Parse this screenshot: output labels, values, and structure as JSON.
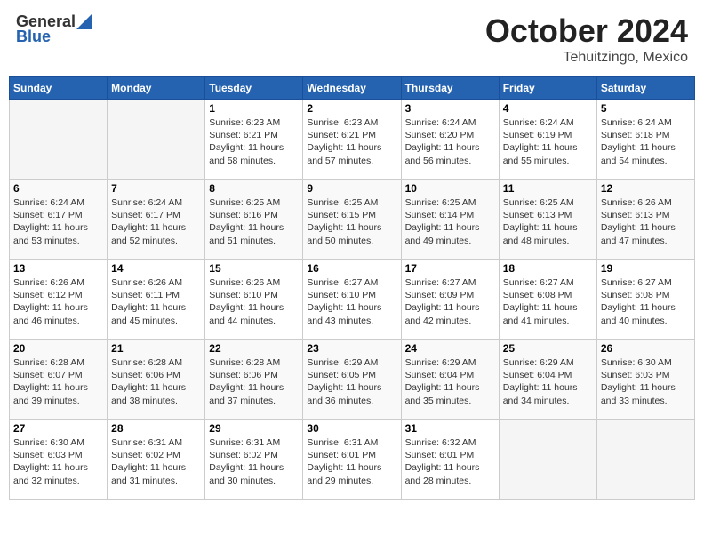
{
  "header": {
    "logo_line1": "General",
    "logo_line2": "Blue",
    "month": "October 2024",
    "location": "Tehuitzingo, Mexico"
  },
  "weekdays": [
    "Sunday",
    "Monday",
    "Tuesday",
    "Wednesday",
    "Thursday",
    "Friday",
    "Saturday"
  ],
  "weeks": [
    [
      {
        "day": "",
        "info": ""
      },
      {
        "day": "",
        "info": ""
      },
      {
        "day": "1",
        "info": "Sunrise: 6:23 AM\nSunset: 6:21 PM\nDaylight: 11 hours and 58 minutes."
      },
      {
        "day": "2",
        "info": "Sunrise: 6:23 AM\nSunset: 6:21 PM\nDaylight: 11 hours and 57 minutes."
      },
      {
        "day": "3",
        "info": "Sunrise: 6:24 AM\nSunset: 6:20 PM\nDaylight: 11 hours and 56 minutes."
      },
      {
        "day": "4",
        "info": "Sunrise: 6:24 AM\nSunset: 6:19 PM\nDaylight: 11 hours and 55 minutes."
      },
      {
        "day": "5",
        "info": "Sunrise: 6:24 AM\nSunset: 6:18 PM\nDaylight: 11 hours and 54 minutes."
      }
    ],
    [
      {
        "day": "6",
        "info": "Sunrise: 6:24 AM\nSunset: 6:17 PM\nDaylight: 11 hours and 53 minutes."
      },
      {
        "day": "7",
        "info": "Sunrise: 6:24 AM\nSunset: 6:17 PM\nDaylight: 11 hours and 52 minutes."
      },
      {
        "day": "8",
        "info": "Sunrise: 6:25 AM\nSunset: 6:16 PM\nDaylight: 11 hours and 51 minutes."
      },
      {
        "day": "9",
        "info": "Sunrise: 6:25 AM\nSunset: 6:15 PM\nDaylight: 11 hours and 50 minutes."
      },
      {
        "day": "10",
        "info": "Sunrise: 6:25 AM\nSunset: 6:14 PM\nDaylight: 11 hours and 49 minutes."
      },
      {
        "day": "11",
        "info": "Sunrise: 6:25 AM\nSunset: 6:13 PM\nDaylight: 11 hours and 48 minutes."
      },
      {
        "day": "12",
        "info": "Sunrise: 6:26 AM\nSunset: 6:13 PM\nDaylight: 11 hours and 47 minutes."
      }
    ],
    [
      {
        "day": "13",
        "info": "Sunrise: 6:26 AM\nSunset: 6:12 PM\nDaylight: 11 hours and 46 minutes."
      },
      {
        "day": "14",
        "info": "Sunrise: 6:26 AM\nSunset: 6:11 PM\nDaylight: 11 hours and 45 minutes."
      },
      {
        "day": "15",
        "info": "Sunrise: 6:26 AM\nSunset: 6:10 PM\nDaylight: 11 hours and 44 minutes."
      },
      {
        "day": "16",
        "info": "Sunrise: 6:27 AM\nSunset: 6:10 PM\nDaylight: 11 hours and 43 minutes."
      },
      {
        "day": "17",
        "info": "Sunrise: 6:27 AM\nSunset: 6:09 PM\nDaylight: 11 hours and 42 minutes."
      },
      {
        "day": "18",
        "info": "Sunrise: 6:27 AM\nSunset: 6:08 PM\nDaylight: 11 hours and 41 minutes."
      },
      {
        "day": "19",
        "info": "Sunrise: 6:27 AM\nSunset: 6:08 PM\nDaylight: 11 hours and 40 minutes."
      }
    ],
    [
      {
        "day": "20",
        "info": "Sunrise: 6:28 AM\nSunset: 6:07 PM\nDaylight: 11 hours and 39 minutes."
      },
      {
        "day": "21",
        "info": "Sunrise: 6:28 AM\nSunset: 6:06 PM\nDaylight: 11 hours and 38 minutes."
      },
      {
        "day": "22",
        "info": "Sunrise: 6:28 AM\nSunset: 6:06 PM\nDaylight: 11 hours and 37 minutes."
      },
      {
        "day": "23",
        "info": "Sunrise: 6:29 AM\nSunset: 6:05 PM\nDaylight: 11 hours and 36 minutes."
      },
      {
        "day": "24",
        "info": "Sunrise: 6:29 AM\nSunset: 6:04 PM\nDaylight: 11 hours and 35 minutes."
      },
      {
        "day": "25",
        "info": "Sunrise: 6:29 AM\nSunset: 6:04 PM\nDaylight: 11 hours and 34 minutes."
      },
      {
        "day": "26",
        "info": "Sunrise: 6:30 AM\nSunset: 6:03 PM\nDaylight: 11 hours and 33 minutes."
      }
    ],
    [
      {
        "day": "27",
        "info": "Sunrise: 6:30 AM\nSunset: 6:03 PM\nDaylight: 11 hours and 32 minutes."
      },
      {
        "day": "28",
        "info": "Sunrise: 6:31 AM\nSunset: 6:02 PM\nDaylight: 11 hours and 31 minutes."
      },
      {
        "day": "29",
        "info": "Sunrise: 6:31 AM\nSunset: 6:02 PM\nDaylight: 11 hours and 30 minutes."
      },
      {
        "day": "30",
        "info": "Sunrise: 6:31 AM\nSunset: 6:01 PM\nDaylight: 11 hours and 29 minutes."
      },
      {
        "day": "31",
        "info": "Sunrise: 6:32 AM\nSunset: 6:01 PM\nDaylight: 11 hours and 28 minutes."
      },
      {
        "day": "",
        "info": ""
      },
      {
        "day": "",
        "info": ""
      }
    ]
  ]
}
